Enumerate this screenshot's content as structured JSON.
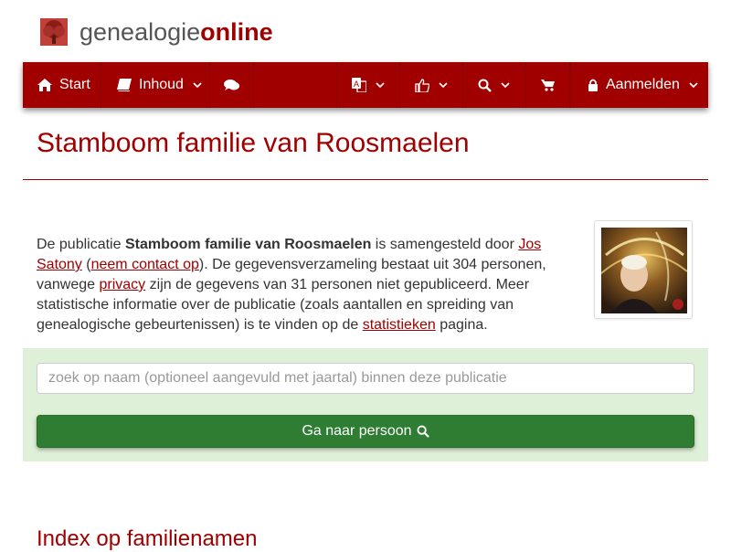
{
  "brand": {
    "name_part1": "genealogie",
    "name_part2": "online",
    "accent_color": "#a00000",
    "logo_icon": "tree-logo-icon"
  },
  "nav": {
    "start_label": "Start",
    "start_icon": "home-icon",
    "inhoud_label": "Inhoud",
    "inhoud_icon": "book-icon",
    "chat_icon": "comments-icon",
    "language_icon": "translate-icon",
    "like_icon": "thumbs-up-icon",
    "search_icon": "search-icon",
    "cart_icon": "shopping-cart-icon",
    "login_label": "Aanmelden",
    "login_icon": "lock-icon",
    "dropdown_icon": "chevron-down-icon"
  },
  "page": {
    "title": "Stamboom familie van Roosmaelen"
  },
  "intro": {
    "t1": "De publicatie ",
    "pub_name": "Stamboom familie van Roosmaelen",
    "t2": " is samengesteld door ",
    "author_link": "Jos Satony",
    "t3": " (",
    "contact_link": "neem contact op",
    "t4": "). De gegevensverzameling bestaat uit 304 personen, vanwege ",
    "privacy_link": "privacy",
    "t5": " zijn de gegevens van 31 personen niet gepubliceerd. Meer statistische informatie over de publicatie (zoals aantallen en spreiding van genealogische gebeurtenissen) is te vinden op de ",
    "stats_link": "statistieken",
    "t6": " pagina."
  },
  "search": {
    "placeholder": "zoek op naam (optioneel aangevuld met jaartal) binnen deze publicatie",
    "button_label": "Ga naar persoon",
    "panel_color": "#dff0d8",
    "button_color": "#2e7d32"
  },
  "sections": {
    "index_heading": "Index op familienamen"
  }
}
